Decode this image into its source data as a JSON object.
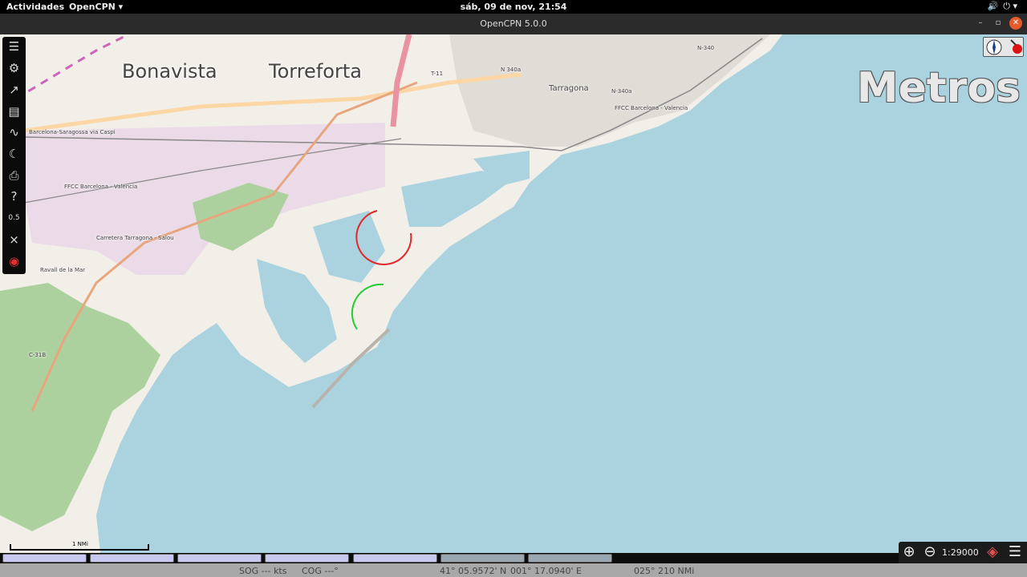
{
  "topbar": {
    "activities": "Actividades",
    "app_menu": "OpenCPN ▾",
    "clock": "sáb, 09 de nov, 21:54",
    "volume_icon": "🔊",
    "power_icon": "⏻ ▾"
  },
  "window": {
    "title": "OpenCPN 5.0.0",
    "minimize": "–",
    "maximize": "▫",
    "close": "✕"
  },
  "toolbar": [
    {
      "icon": "menu-icon",
      "glyph": "☰"
    },
    {
      "icon": "gear-icon",
      "glyph": "⚙"
    },
    {
      "icon": "route-icon",
      "glyph": "↗"
    },
    {
      "icon": "route-manager-icon",
      "glyph": "▤"
    },
    {
      "icon": "track-icon",
      "glyph": "∿"
    },
    {
      "icon": "tide-icon",
      "glyph": "☾"
    },
    {
      "icon": "print-icon",
      "glyph": "⎙"
    },
    {
      "icon": "help-icon",
      "glyph": "?"
    },
    {
      "icon": "ais-icon",
      "glyph": "0.5"
    },
    {
      "icon": "gps-icon",
      "glyph": "⨯"
    },
    {
      "icon": "mob-icon",
      "glyph": "◉"
    }
  ],
  "map": {
    "places": [
      "Bonavista",
      "Torreforta"
    ],
    "city": "Tarragona",
    "roads": [
      "N 340a",
      "N-340a",
      "N-340",
      "T-11",
      "C-31B"
    ],
    "rail_labels": [
      "FFCC Barcelona - Valencia",
      "FFCC Barcelona - Valencia",
      "Carretera Tarragona - Salou",
      "Barcelona-Saragossa via Caspi",
      "Ravall de la Mar"
    ],
    "units_label": "Metros",
    "scale_text": "1 NMi"
  },
  "zoom": {
    "zoom_in": "⊕",
    "zoom_out": "⊖",
    "scale": "1:29000",
    "menu": "☰"
  },
  "status": {
    "sog": "SOG --- kts",
    "cog": "COG ---°",
    "lat": "41° 05.9572' N",
    "lon": "001° 17.0940' E",
    "bearing": "025°  210 NMi"
  },
  "colors": {
    "sea": "#aad3df",
    "land": "#f2efe9",
    "industrial": "#ebdbe8",
    "forest": "#add19e",
    "road": "#e8a67f",
    "motorway": "#e892a2"
  }
}
